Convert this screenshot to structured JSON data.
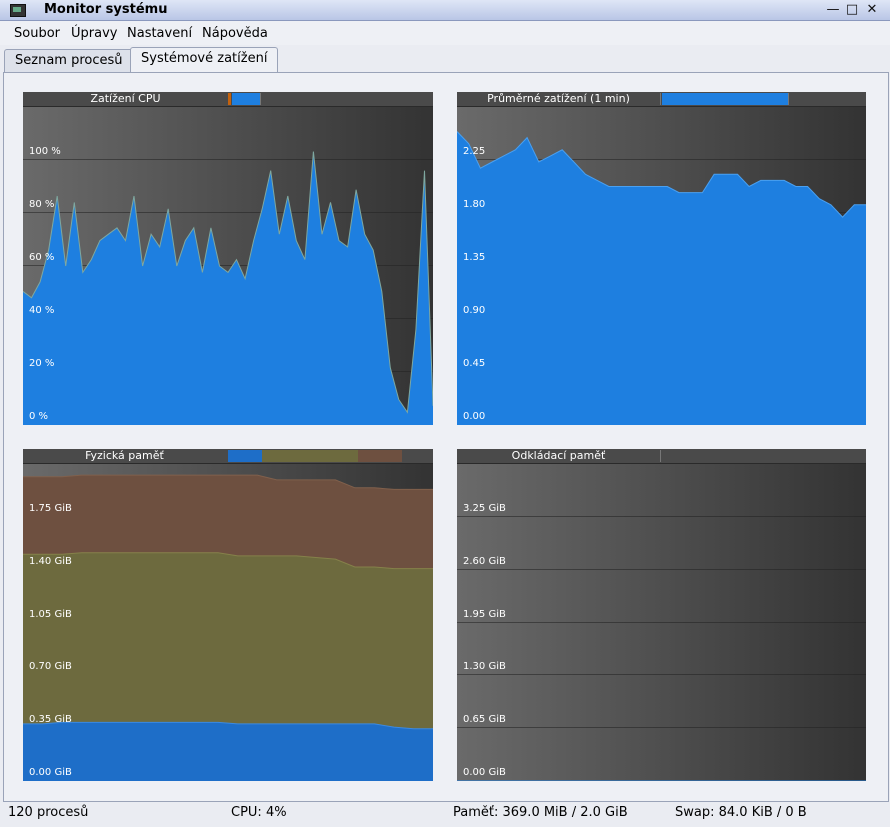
{
  "window": {
    "title": "Monitor systému",
    "buttons": [
      "minimize",
      "maximize",
      "close"
    ]
  },
  "menubar": {
    "items": [
      "Soubor",
      "Úpravy",
      "Nastavení",
      "Nápověda"
    ]
  },
  "tabs": [
    {
      "label": "Seznam procesů",
      "active": false
    },
    {
      "label": "Systémové zatížení",
      "active": true
    }
  ],
  "charts": {
    "cpu": {
      "title": "Zatížení CPU",
      "y_ticks": [
        "100 %",
        "80 %",
        "60 %",
        "40 %",
        "20 %",
        "0 %"
      ]
    },
    "load": {
      "title": "Průměrné zatížení (1 min)",
      "y_ticks": [
        "2.25",
        "1.80",
        "1.35",
        "0.90",
        "0.45",
        "0.00"
      ]
    },
    "mem": {
      "title": "Fyzická paměť",
      "y_ticks": [
        "1.75 GiB",
        "1.40 GiB",
        "1.05 GiB",
        "0.70 GiB",
        "0.35 GiB",
        "0.00 GiB"
      ]
    },
    "swap": {
      "title": "Odkládací paměť",
      "y_ticks": [
        "3.25 GiB",
        "2.60 GiB",
        "1.95 GiB",
        "1.30 GiB",
        "0.65 GiB",
        "0.00 GiB"
      ]
    }
  },
  "colors": {
    "cpu_user": "#1e7fe0",
    "cpu_system": "#c4620e",
    "cpu_nice": "#d89fd6",
    "load": "#1e7fe0",
    "mem_used": "#1e6ec8",
    "mem_buffers": "#6d6a3e",
    "mem_cache": "#6e5040",
    "swap": "#1e7fe0"
  },
  "chart_data": [
    {
      "type": "area",
      "title": "Zatížení CPU",
      "ylim": [
        0,
        100
      ],
      "y_unit": "%",
      "series": [
        {
          "values": [
            42,
            40,
            45,
            55,
            72,
            50,
            70,
            48,
            52,
            58,
            60,
            62,
            58,
            72,
            50,
            60,
            56,
            68,
            50,
            58,
            62,
            48,
            62,
            50,
            48,
            52,
            46,
            58,
            68,
            80,
            60,
            72,
            58,
            52,
            86,
            60,
            70,
            58,
            56,
            74,
            60,
            55,
            42,
            18,
            8,
            4,
            30,
            80,
            6
          ]
        },
        {
          "values": [
            3,
            5,
            8,
            4,
            6,
            3,
            5,
            4,
            6,
            3,
            4,
            5,
            3,
            4,
            6,
            3,
            4,
            3,
            5,
            4,
            3,
            4,
            5,
            3,
            4,
            6,
            3,
            4,
            5,
            4,
            3,
            6,
            4,
            5,
            3,
            4,
            6,
            3,
            4,
            3,
            5,
            4,
            3,
            4,
            3,
            2,
            3,
            5,
            3
          ]
        },
        {
          "values": [
            1,
            1,
            1,
            1,
            1,
            1,
            1,
            1,
            1,
            1,
            1,
            1,
            1,
            1,
            1,
            1,
            1,
            1,
            1,
            1,
            1,
            1,
            1,
            1,
            1,
            1,
            1,
            1,
            1,
            1,
            1,
            1,
            1,
            1,
            1,
            1,
            1,
            1,
            1,
            1,
            1,
            1,
            1,
            1,
            1,
            1,
            1,
            1,
            1
          ]
        }
      ]
    },
    {
      "type": "area",
      "title": "Průměrné zatížení (1 min)",
      "ylim": [
        0,
        2.6
      ],
      "series": [
        {
          "values": [
            2.4,
            2.3,
            2.1,
            2.15,
            2.2,
            2.25,
            2.35,
            2.15,
            2.2,
            2.25,
            2.15,
            2.05,
            2.0,
            1.95,
            1.95,
            1.95,
            1.95,
            1.95,
            1.95,
            1.9,
            1.9,
            1.9,
            2.05,
            2.05,
            2.05,
            1.95,
            2.0,
            2.0,
            2.0,
            1.95,
            1.95,
            1.85,
            1.8,
            1.7,
            1.8,
            1.8
          ]
        }
      ]
    },
    {
      "type": "area",
      "title": "Fyzická paměť",
      "ylim": [
        0,
        2.0
      ],
      "series": [
        {
          "values": [
            0.36,
            0.36,
            0.37,
            0.37,
            0.37,
            0.37,
            0.37,
            0.37,
            0.37,
            0.37,
            0.37,
            0.36,
            0.36,
            0.36,
            0.36,
            0.36,
            0.36,
            0.36,
            0.36,
            0.34,
            0.33,
            0.33
          ]
        },
        {
          "values": [
            1.43,
            1.43,
            1.43,
            1.44,
            1.44,
            1.44,
            1.44,
            1.44,
            1.44,
            1.44,
            1.44,
            1.42,
            1.42,
            1.42,
            1.42,
            1.41,
            1.4,
            1.35,
            1.35,
            1.34,
            1.34,
            1.34
          ]
        },
        {
          "values": [
            1.92,
            1.92,
            1.92,
            1.93,
            1.93,
            1.93,
            1.93,
            1.93,
            1.93,
            1.93,
            1.93,
            1.93,
            1.93,
            1.9,
            1.9,
            1.9,
            1.9,
            1.85,
            1.85,
            1.84,
            1.84,
            1.84
          ]
        }
      ]
    },
    {
      "type": "area",
      "title": "Odkládací paměť",
      "ylim": [
        0,
        3.9
      ],
      "series": [
        {
          "values": [
            0.0001,
            0.0001,
            0.0001,
            0.0001,
            0.0001,
            0.0001,
            0.0001,
            0.0001,
            0.0001,
            0.0001
          ]
        }
      ]
    }
  ],
  "statusbar": {
    "processes": "120 procesů",
    "cpu": "CPU: 4%",
    "memory": "Paměť: 369.0 MiB / 2.0 GiB",
    "swap": "Swap: 84.0 KiB / 0 B"
  }
}
